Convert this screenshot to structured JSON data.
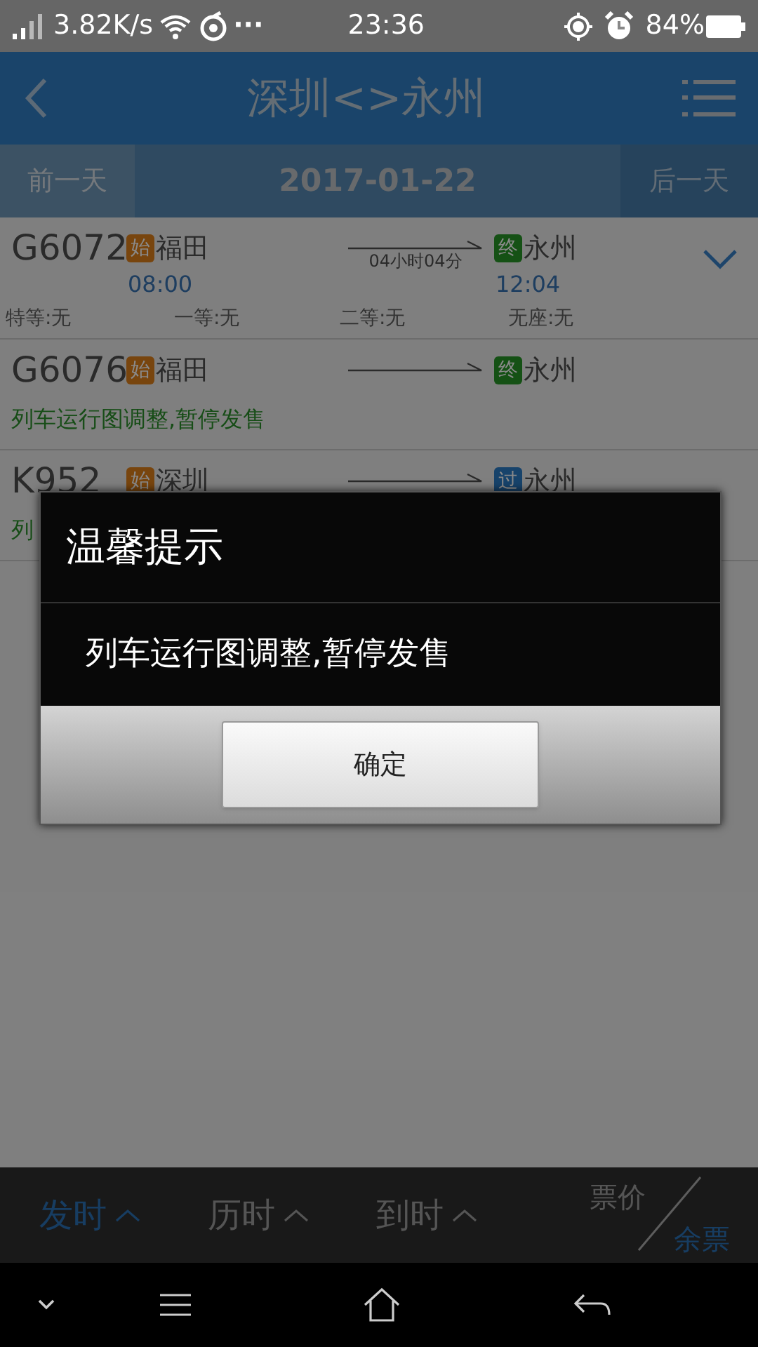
{
  "status_bar": {
    "speed": "3.82K/s",
    "more": "···",
    "time": "23:36",
    "battery": "84%"
  },
  "header": {
    "title": "深圳<>永州"
  },
  "date_bar": {
    "prev": "前一天",
    "date": "2017-01-22",
    "next": "后一天",
    "next_disabled": true
  },
  "trains": [
    {
      "number": "G6072",
      "origin": {
        "badge": "始",
        "color": "#78450e",
        "name": "福田"
      },
      "depart": "08:00",
      "duration": "04小时04分",
      "destination": {
        "badge": "终",
        "color": "#155115",
        "name": "永州"
      },
      "arrive": "12:04",
      "expanded": false,
      "seats": [
        "特等:无",
        "一等:无",
        "二等:无",
        "无座:无"
      ]
    },
    {
      "number": "G6076",
      "origin": {
        "badge": "始",
        "color": "#78450e",
        "name": "福田"
      },
      "destination": {
        "badge": "终",
        "color": "#155115",
        "name": "永州"
      },
      "note": "列车运行图调整,暂停发售"
    },
    {
      "number": "K952",
      "origin": {
        "badge": "始",
        "color": "#78450e",
        "name": "深圳"
      },
      "destination": {
        "badge": "过",
        "color": "#17436b",
        "name": "永州"
      },
      "note": "列"
    }
  ],
  "dialog": {
    "title": "温馨提示",
    "message": "列车运行图调整,暂停发售",
    "button": "确定"
  },
  "sort_bar": [
    {
      "label": "发时",
      "selected": true
    },
    {
      "label": "历时",
      "selected": false
    },
    {
      "label": "到时",
      "selected": false
    }
  ],
  "price_toggle": {
    "top": "票价",
    "bottom": "余票",
    "bottom_selected": true
  }
}
